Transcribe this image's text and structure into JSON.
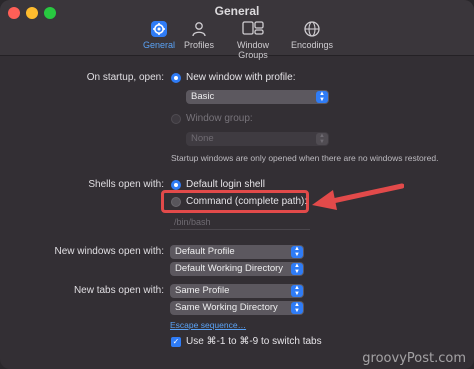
{
  "window": {
    "title": "General"
  },
  "tabs": [
    {
      "label": "General",
      "icon": "gear-icon"
    },
    {
      "label": "Profiles",
      "icon": "person-icon"
    },
    {
      "label": "Window Groups",
      "icon": "window-groups-icon"
    },
    {
      "label": "Encodings",
      "icon": "globe-icon"
    }
  ],
  "startup": {
    "label": "On startup, open:",
    "option1": "New window with profile:",
    "profile_popup": "Basic",
    "option2": "Window group:",
    "group_popup": "None",
    "note": "Startup windows are only opened when there are no windows restored."
  },
  "shells": {
    "label": "Shells open with:",
    "option1": "Default login shell",
    "option2": "Command (complete path):",
    "path_placeholder": "/bin/bash"
  },
  "new_windows": {
    "label": "New windows open with:",
    "profile": "Default Profile",
    "directory": "Default Working Directory"
  },
  "new_tabs": {
    "label": "New tabs open with:",
    "profile": "Same Profile",
    "directory": "Same Working Directory"
  },
  "escape_link": "Escape sequence…",
  "switch_tabs_checkbox": "Use ⌘-1 to ⌘-9 to switch tabs",
  "watermark": "groovyPost.com",
  "colors": {
    "accent": "#2f7cf6",
    "highlight": "#e24a4a"
  }
}
